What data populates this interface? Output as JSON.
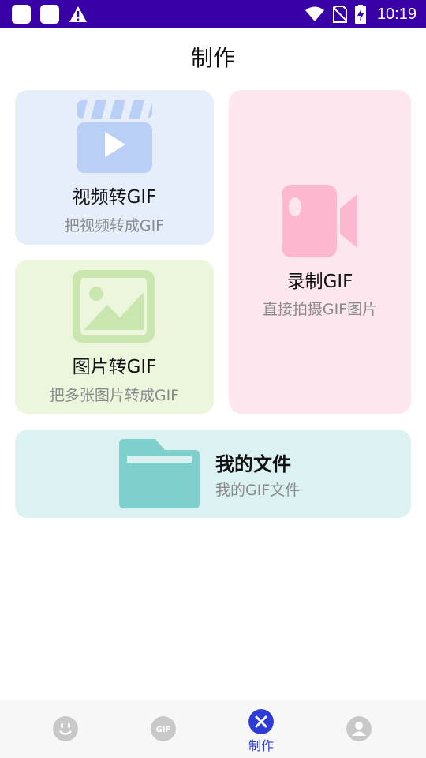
{
  "status_bar": {
    "time": "10:19",
    "icons": [
      "notification-square-icon",
      "notification-square-icon",
      "warning-icon",
      "wifi-icon",
      "no-sim-icon",
      "battery-charging-icon"
    ],
    "background": "#3a00a8"
  },
  "page": {
    "title": "制作"
  },
  "cards": {
    "video": {
      "title": "视频转GIF",
      "subtitle": "把视频转成GIF",
      "icon": "video-clapper-icon",
      "bg": "#e6eefc",
      "icon_color": "#b9cff6"
    },
    "image": {
      "title": "图片转GIF",
      "subtitle": "把多张图片转成GIF",
      "icon": "image-icon",
      "bg": "#ebf6dd",
      "icon_color": "#c9e6ae"
    },
    "record": {
      "title": "录制GIF",
      "subtitle": "直接拍摄GIF图片",
      "icon": "video-camera-icon",
      "bg": "#fde6ee",
      "icon_color": "#fdb8cf"
    },
    "files": {
      "title": "我的文件",
      "subtitle": "我的GIF文件",
      "icon": "folder-icon",
      "bg": "#dcf1f2",
      "icon_color": "#7fd0cd"
    }
  },
  "bottom_nav": {
    "items": [
      {
        "name": "home",
        "icon": "smiley-icon",
        "label": "",
        "active": false
      },
      {
        "name": "gif",
        "icon": "gif-icon",
        "label": "",
        "active": false
      },
      {
        "name": "make",
        "icon": "tools-icon",
        "label": "制作",
        "active": true
      },
      {
        "name": "profile",
        "icon": "user-icon",
        "label": "",
        "active": false
      }
    ],
    "active_color": "#2d3bd6",
    "inactive_color": "#c8c8c8"
  }
}
